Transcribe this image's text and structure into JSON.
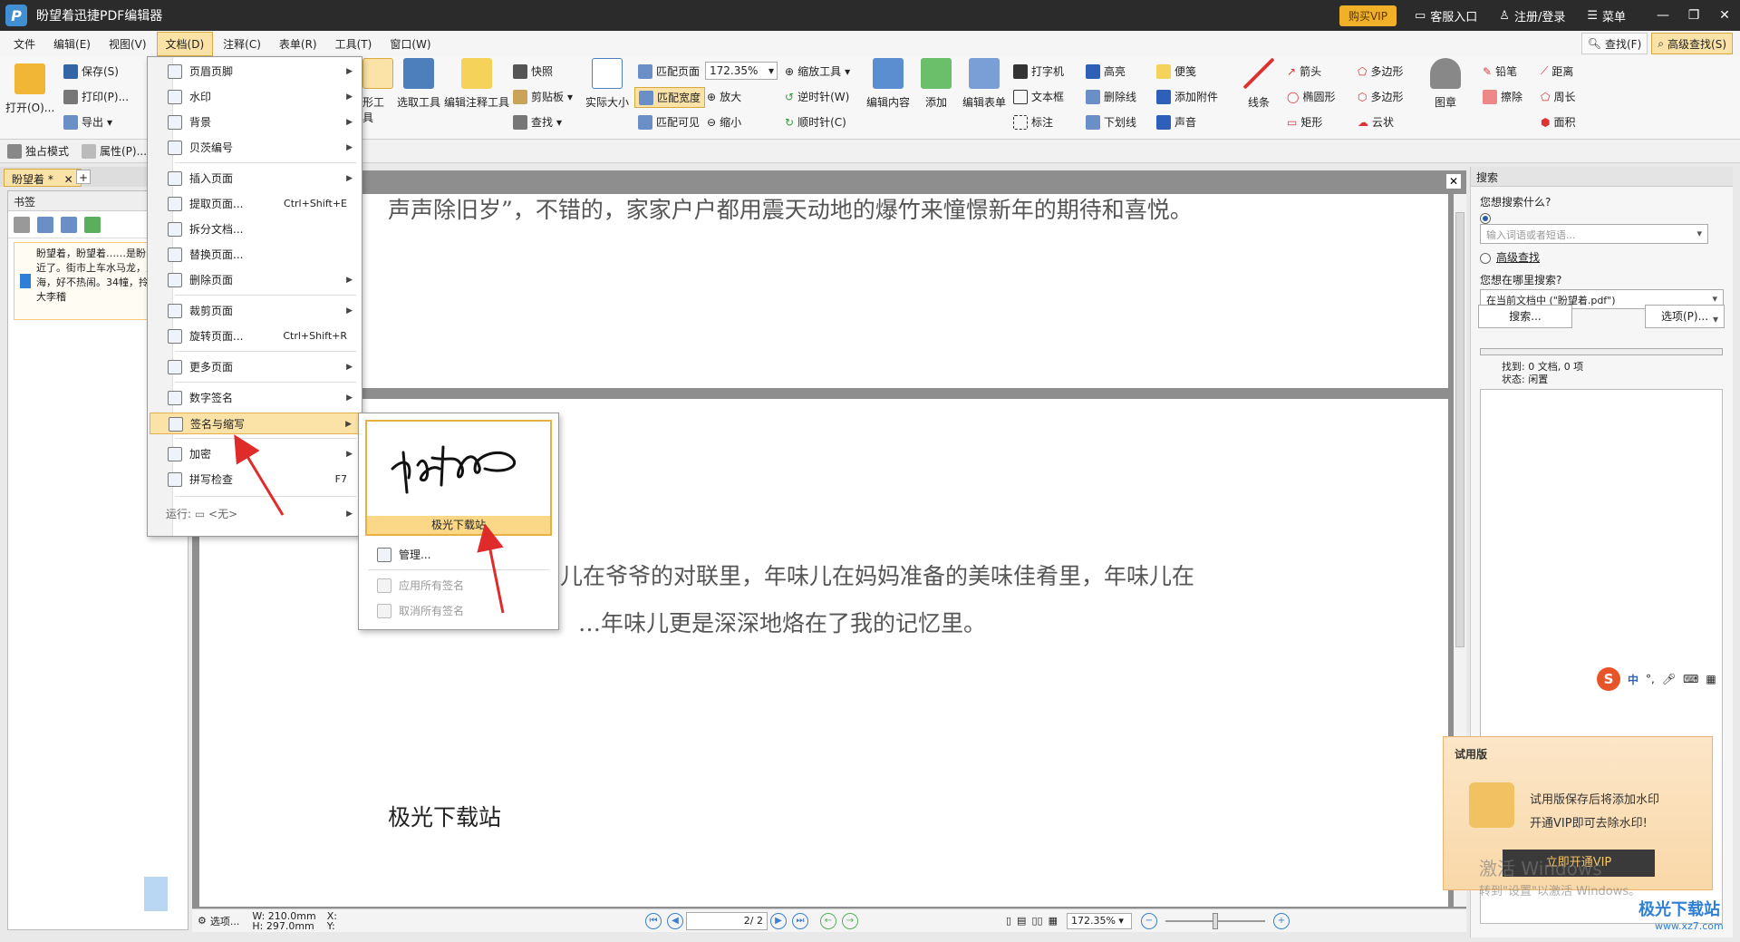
{
  "app": {
    "title": "盼望着迅捷PDF编辑器",
    "logo_letter": "P",
    "buy_vip": "购买VIP",
    "service": "客服入口",
    "login": "注册/登录",
    "menu": "菜单"
  },
  "menubar": {
    "items": [
      "文件",
      "编辑(E)",
      "视图(V)",
      "文档(D)",
      "注释(C)",
      "表单(R)",
      "工具(T)",
      "窗口(W)"
    ],
    "find": "查找(F)",
    "advanced_find": "高级查找(S)"
  },
  "ribbon": {
    "open": "打开(O)...",
    "save": "保存(S)",
    "print": "打印(P)...",
    "export": "导出",
    "hand_tool": "形工具",
    "select_tool": "选取工具",
    "edit_annot_tool": "编辑注释工具",
    "snapshot": "快照",
    "clipboard": "剪贴板",
    "find": "查找",
    "actual_size": "实际大小",
    "fit_page": "匹配页面",
    "fit_width": "匹配宽度",
    "fit_visible": "匹配可见",
    "zoom_value": "172.35%",
    "zoom_in": "放大",
    "zoom_out": "缩小",
    "zoom_tool": "缩放工具",
    "ccw": "逆时针(W)",
    "cw": "顺时针(C)",
    "edit_content": "编辑内容",
    "add": "添加",
    "edit_form": "编辑表单",
    "typewriter": "打字机",
    "textbox": "文本框",
    "callout": "标注",
    "highlight": "高亮",
    "strikeout": "删除线",
    "underline": "下划线",
    "note": "便笺",
    "attach": "添加附件",
    "sound": "声音",
    "line": "线条",
    "arrow": "箭头",
    "ellipse": "椭圆形",
    "rect": "矩形",
    "polygon": "多边形",
    "polyline": "多边形",
    "cloud": "云状",
    "stamp": "图章",
    "pencil": "铅笔",
    "eraser": "擦除",
    "distance": "距离",
    "perimeter": "周长",
    "area": "面积",
    "exclusive_mode": "独占模式",
    "properties": "属性(P)..."
  },
  "tabs": {
    "doc_tab": "盼望着 *"
  },
  "left_panel": {
    "title": "书签",
    "bookmark_text": "盼望着，盼望着……是盼的新年近了。街市上车水马龙，人山人海，好不热闹。34幢，拎着大大李稽"
  },
  "document": {
    "line1": "声声除旧岁”，不错的，家家户户都用震天动地的爆竹来憧憬新年的期待和喜悦。",
    "line2": "儿在爷爷的对联里，年味儿在妈妈准备的美味佳肴里，年味儿在",
    "line3": "…年味儿更是深深地烙在了我的记忆里。",
    "sign_text": "极光下载站"
  },
  "statusbar": {
    "options": "选项...",
    "w": "W: 210.0mm",
    "h": "H: 297.0mm",
    "x": "X:",
    "y": "Y:",
    "page": "2",
    "page_total": "/ 2",
    "zoom": "172.35%"
  },
  "right_panel": {
    "title": "搜索",
    "q_label": "您想搜索什么?",
    "q_placeholder": "输入词语或者短语...",
    "advanced": "高级查找",
    "where_label": "您想在哪里搜索?",
    "where_value": "在当前文档中 (\"盼望着.pdf\")",
    "search_btn": "搜索...",
    "options_btn": "选项(P)...",
    "found": "找到: 0 文档, 0 项",
    "state": "状态: 闲置"
  },
  "trial": {
    "title": "试用版",
    "line1": "试用版保存后将添加水印",
    "line2": "开通VIP即可去除水印!",
    "button": "立即开通VIP",
    "activate1": "激活 Windows",
    "activate2": "转到\"设置\"以激活 Windows。"
  },
  "ime": {
    "logo": "S",
    "lang": "中"
  },
  "doc_menu": {
    "items": [
      {
        "label": "页眉页脚",
        "arrow": "▶"
      },
      {
        "label": "水印",
        "arrow": "▶"
      },
      {
        "label": "背景",
        "arrow": "▶"
      },
      {
        "label": "贝茨编号",
        "arrow": "▶"
      },
      {
        "label": "插入页面",
        "arrow": "▶"
      },
      {
        "label": "提取页面...",
        "shortcut": "Ctrl+Shift+E"
      },
      {
        "label": "拆分文档..."
      },
      {
        "label": "替换页面..."
      },
      {
        "label": "删除页面",
        "arrow": "▶"
      },
      {
        "label": "裁剪页面",
        "arrow": "▶"
      },
      {
        "label": "旋转页面...",
        "shortcut": "Ctrl+Shift+R"
      },
      {
        "label": "更多页面",
        "arrow": "▶"
      },
      {
        "label": "数字签名",
        "arrow": "▶"
      },
      {
        "label": "签名与缩写",
        "arrow": "▶"
      },
      {
        "label": "加密",
        "arrow": "▶"
      },
      {
        "label": "拼写检查",
        "shortcut": "F7"
      },
      {
        "label": "运行: ▭ <无>",
        "arrow": "▶"
      }
    ]
  },
  "sign_submenu": {
    "signature_label": "极光下载站",
    "manage": "管理...",
    "apply_all": "应用所有签名",
    "cancel_all": "取消所有签名"
  },
  "watermark_site": {
    "name": "极光下载站",
    "url": "www.xz7.com"
  },
  "colors": {
    "accent_highlight": "#fbe3a8",
    "accent_border": "#d9a93e",
    "titlebar": "#2b2b2b",
    "annotation_arrow": "#e02b2b"
  }
}
